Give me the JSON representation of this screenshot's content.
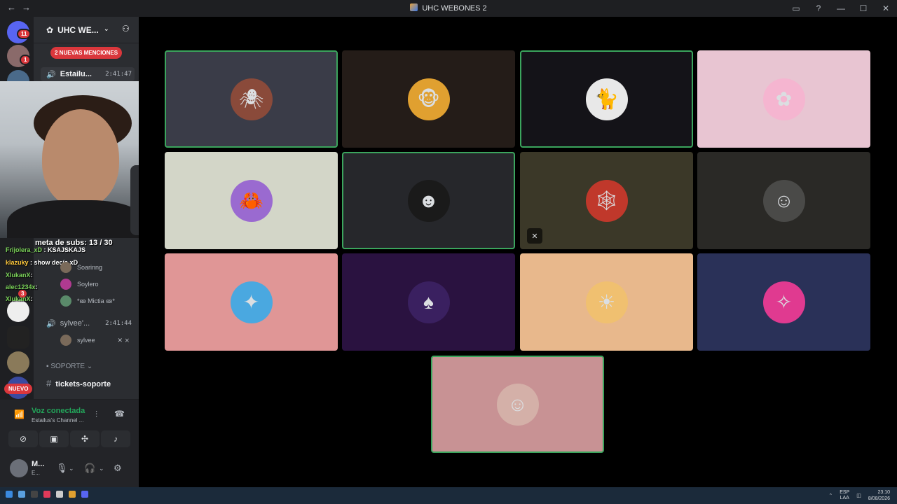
{
  "window": {
    "title": "UHC WEBONES 2",
    "nav_back": "←",
    "nav_forward": "→",
    "inbox_icon": "▭",
    "help_icon": "?",
    "minimize": "—",
    "maximize": "☐",
    "close": "✕"
  },
  "guilds": {
    "home_badge": "11",
    "dm_badge_1": "1",
    "dm_badge_2": "1",
    "dm_badge_3": "3",
    "nuevo": "NUEVO"
  },
  "server": {
    "name": "UHC WE...",
    "mentions": "2 NUEVAS MENCIONES"
  },
  "voice_channels": [
    {
      "name": "Estailu...",
      "time": "2:41:47"
    },
    {
      "name": "sylvee'...",
      "time": "2:41:44"
    }
  ],
  "voice_users": [
    "Soarinng",
    "Soylero",
    "*ꙭ Mictia ꙭ*",
    "sylvee"
  ],
  "stream_overlay": {
    "sub_goal": "meta de subs: 13 / 30",
    "chat": [
      {
        "user": "Frijolera_xD",
        "msg": ": KSAJSKAJS"
      },
      {
        "user": "klazuky",
        "msg": ": show decía xD"
      },
      {
        "user": "XlukanX",
        "msg": ":"
      },
      {
        "user": "alec1234x",
        "msg": ":"
      },
      {
        "user": "XlukanX",
        "msg": ":"
      }
    ]
  },
  "category": "SOPORTE",
  "text_channel": "tickets-soporte",
  "voice_status": {
    "state": "Voz conectada",
    "channel": "Estailus's Channel ..."
  },
  "user": {
    "name": "M...",
    "status": "E..."
  },
  "colors": {
    "speaking_border": "#3ba55d",
    "mention_red": "#da373c",
    "connected_green": "#23a55a"
  },
  "tiles": [
    {
      "bg": "#3a3c48",
      "avatar_bg": "#8a4a3a",
      "glyph": "🕷",
      "speaking": true
    },
    {
      "bg": "#241c18",
      "avatar_bg": "#e0a030",
      "glyph": "🐵",
      "speaking": false
    },
    {
      "bg": "#141318",
      "avatar_bg": "#e8e8e8",
      "glyph": "🐈",
      "speaking": true
    },
    {
      "bg": "#e8c5d2",
      "avatar_bg": "#f5b5d0",
      "glyph": "✿",
      "speaking": false
    },
    {
      "bg": "#d3d6c8",
      "avatar_bg": "#9a6ad0",
      "glyph": "🦀",
      "speaking": false
    },
    {
      "bg": "#26272b",
      "avatar_bg": "#1a1a1a",
      "glyph": "☻",
      "speaking": true
    },
    {
      "bg": "#3b3828",
      "avatar_bg": "#c0382b",
      "glyph": "🕸",
      "speaking": false,
      "muted": true
    },
    {
      "bg": "#2a2926",
      "avatar_bg": "#4a4a48",
      "glyph": "☺",
      "speaking": false
    },
    {
      "bg": "#e09696",
      "avatar_bg": "#4aa8e0",
      "glyph": "✦",
      "speaking": false
    },
    {
      "bg": "#2a1240",
      "avatar_bg": "#3a2060",
      "glyph": "♠",
      "speaking": false
    },
    {
      "bg": "#e8b88c",
      "avatar_bg": "#f0c070",
      "glyph": "☀",
      "speaking": false
    },
    {
      "bg": "#2a3158",
      "avatar_bg": "#e03a90",
      "glyph": "✧",
      "speaking": false
    },
    {
      "bg": "#c89294",
      "avatar_bg": "#d4b0a8",
      "glyph": "☺",
      "speaking": true
    }
  ],
  "taskbar": {
    "lang_top": "ESP",
    "lang_bottom": "LAA",
    "time": "23:10",
    "date": "8/08/2026"
  }
}
